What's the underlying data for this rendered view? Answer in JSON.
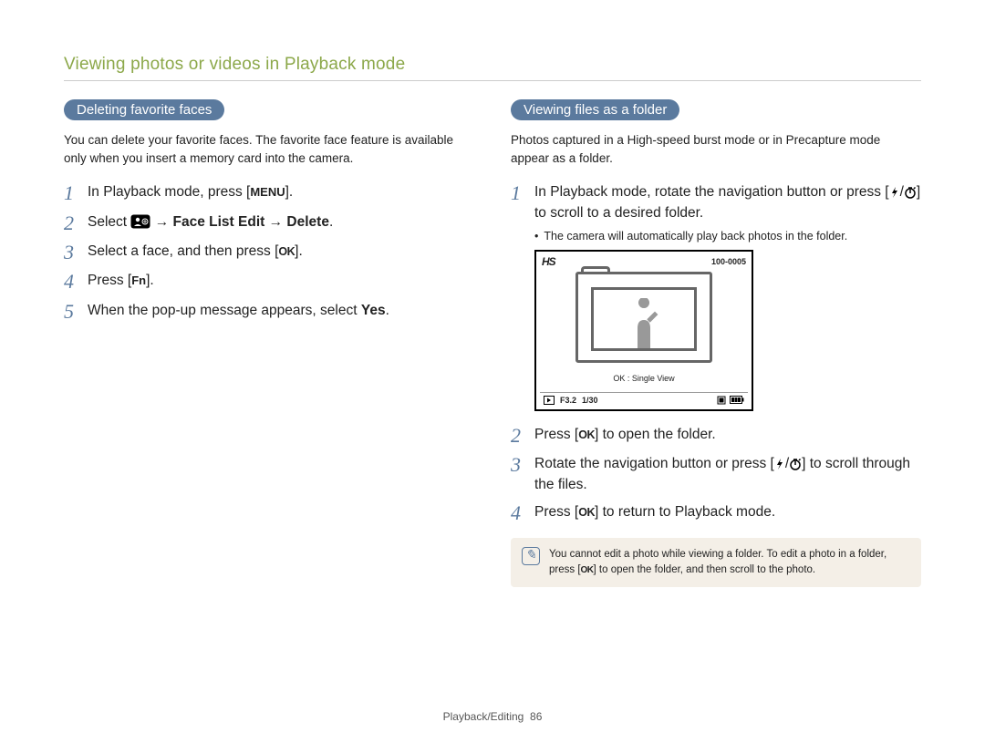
{
  "header": {
    "title": "Viewing photos or videos in Playback mode"
  },
  "left": {
    "pill": "Deleting favorite faces",
    "intro": "You can delete your favorite faces. The favorite face feature is available only when you insert a memory card into the camera.",
    "steps": {
      "s1_a": "In Playback mode, press [",
      "s1_menu": "MENU",
      "s1_b": "].",
      "s2_a": "Select ",
      "s2_b": " → ",
      "s2_bold1": "Face List Edit",
      "s2_c": " → ",
      "s2_bold2": "Delete",
      "s2_d": ".",
      "s3_a": "Select a face, and then press [",
      "s3_ok": "OK",
      "s3_b": "].",
      "s4_a": "Press [",
      "s4_fn": "Fn",
      "s4_b": "].",
      "s5_a": "When the pop-up message appears, select ",
      "s5_yes": "Yes",
      "s5_b": "."
    }
  },
  "right": {
    "pill": "Viewing files as a folder",
    "intro": "Photos captured in a High-speed burst mode or in Precapture mode appear as a folder.",
    "steps": {
      "s1_a": "In Playback mode, rotate the navigation button or press [",
      "s1_b": "/",
      "s1_c": "] to scroll to a desired folder.",
      "s1_sub": "The camera will automatically play back photos in the folder.",
      "screen": {
        "hs": "HS",
        "filecode": "100-0005",
        "caption": "OK : Single View",
        "ap": "F3.2",
        "shutter": "1/30"
      },
      "s2_a": "Press [",
      "s2_ok": "OK",
      "s2_b": "] to open the folder.",
      "s3_a": "Rotate the navigation button or press [",
      "s3_b": "/",
      "s3_c": "] to scroll through the files.",
      "s4_a": "Press [",
      "s4_ok": "OK",
      "s4_b": "] to return to Playback mode."
    },
    "note_a": "You cannot edit a photo while viewing a folder. To edit a photo in a folder, press [",
    "note_ok": "OK",
    "note_b": "] to open the folder, and then scroll to the photo."
  },
  "footer": {
    "section": "Playback/Editing",
    "page": "86"
  }
}
